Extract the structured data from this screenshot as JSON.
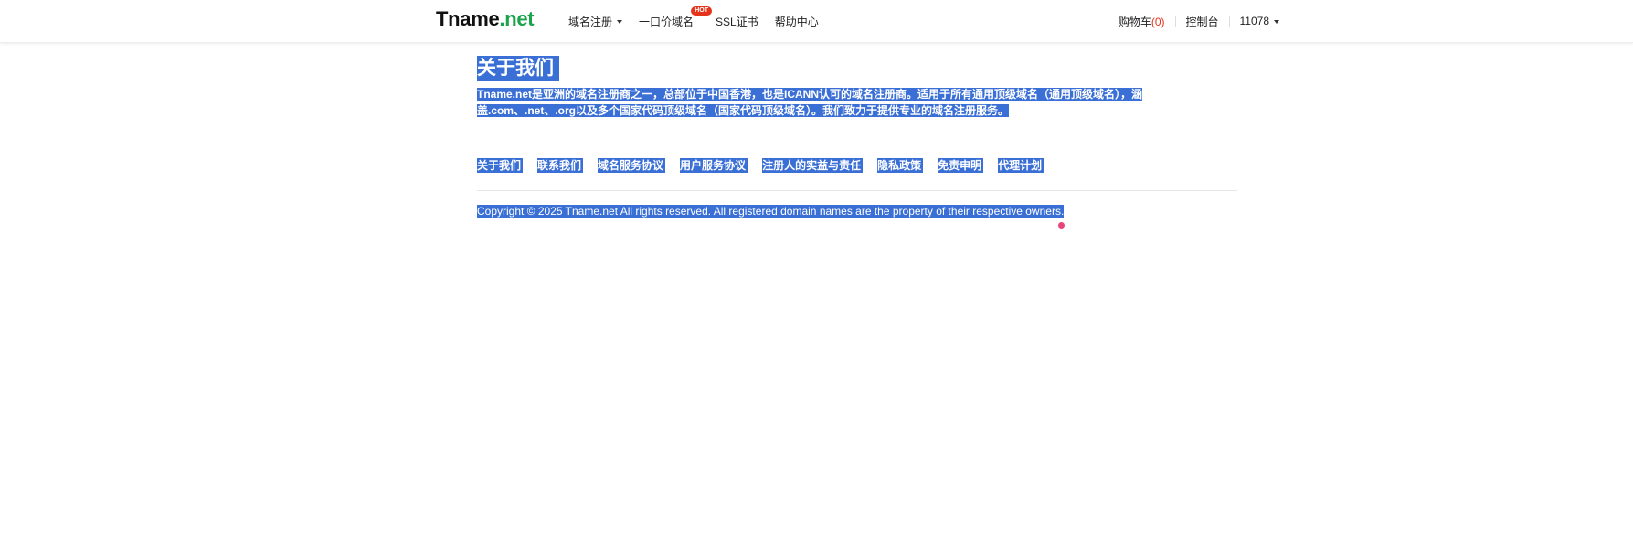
{
  "header": {
    "logo_brand": "Tname",
    "logo_tld": ".net",
    "nav": [
      {
        "label": "域名注册",
        "has_dropdown": true
      },
      {
        "label": "一口价域名",
        "badge": "HOT"
      },
      {
        "label": "SSL证书"
      },
      {
        "label": "帮助中心"
      }
    ],
    "cart_label": "购物车",
    "cart_count": "(0)",
    "console_label": "控制台",
    "user_label": "11078"
  },
  "about": {
    "title": "关于我们",
    "description": "Tname.net是亚洲的域名注册商之一，总部位于中国香港，也是ICANN认可的域名注册商。适用于所有通用顶级域名（通用顶级域名），涵盖.com、.net、.org以及多个国家代码顶级域名（国家代码顶级域名）。我们致力于提供专业的域名注册服务。"
  },
  "footer": {
    "links": [
      "关于我们",
      "联系我们",
      "域名服务协议",
      "用户服务协议",
      "注册人的实益与责任",
      "隐私政策",
      "免责申明",
      "代理计划"
    ],
    "copyright": "Copyright © 2025 Tname.net All rights reserved. All registered domain names are the property of their respective owners."
  },
  "colors": {
    "brand_green": "#1aa34a",
    "selection_blue": "#3a6fd6",
    "hot_red": "#e5341b"
  }
}
